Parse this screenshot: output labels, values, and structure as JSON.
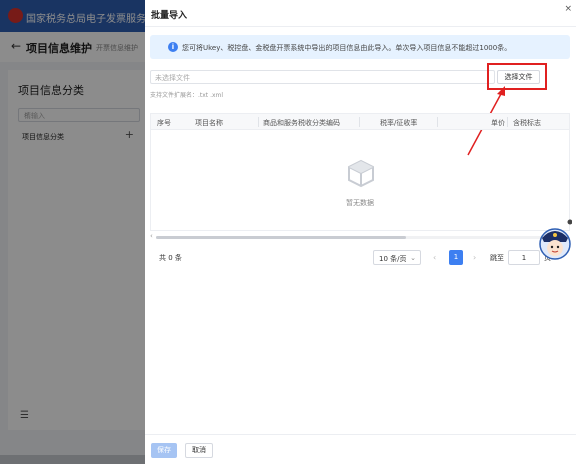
{
  "app": {
    "title": "国家税务总局电子发票服务平",
    "page_title": "项目信息维护",
    "breadcrumb": "开票信息维护",
    "panel": {
      "title": "项目信息分类",
      "search_placeholder": "请输入",
      "item": "项目信息分类",
      "add_symbol": "+",
      "menu_symbol": "☰"
    }
  },
  "drawer": {
    "title": "批量导入",
    "close_symbol": "×",
    "notice": "您可将Ukey、税控盘、金税盘开票系统中导出的项目信息由此导入。单次导入项目信息不能超过1000条。",
    "file_placeholder": "未选择文件",
    "choose_file": "选择文件",
    "ext_hint": "支持文件扩展名：.txt .xml",
    "table": {
      "columns": [
        "序号",
        "项目名称",
        "商品和服务税收分类编码",
        "税率/征收率",
        "单价",
        "含税标志"
      ],
      "empty_text": "暂无数据"
    },
    "pagination": {
      "total": "共 0 条",
      "page_size": "10 条/页",
      "current_page": "1",
      "jump_label": "跳至",
      "jump_value": "1",
      "jump_unit": "页"
    },
    "footer": {
      "save": "保存",
      "cancel": "取消"
    }
  },
  "colors": {
    "primary": "#3d7ff1",
    "header": "#2f5fb3",
    "highlight": "#e02020",
    "notice_bg": "#e6f2ff"
  }
}
